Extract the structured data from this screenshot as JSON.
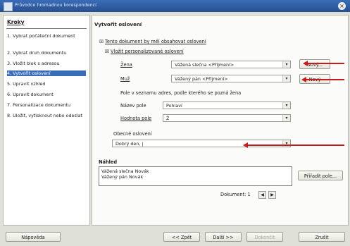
{
  "window": {
    "title": "Průvodce hromadnou korespondencí"
  },
  "steps": {
    "heading": "Kroky",
    "items": [
      {
        "label": "1. Vybrat počáteční dokument"
      },
      {
        "label": "2. Vybrat druh dokumentu"
      },
      {
        "label": "3. Vložit blok s adresou"
      },
      {
        "label": "4. Vytvořit oslovení"
      },
      {
        "label": "5. Upravit vzhled"
      },
      {
        "label": "6. Upravit dokument"
      },
      {
        "label": "7. Personalizace dokumentu"
      },
      {
        "label": "8. Uložit, vytisknout nebo odeslat"
      }
    ],
    "selected_index": 3
  },
  "main": {
    "title": "Vytvořit oslovení",
    "cb_salutation": "Tento dokument by měl obsahovat oslovení",
    "cb_personal": "Vložit personalizované oslovení",
    "female_label": "Žena",
    "female_value": "Vážená slečna <Příjmení>",
    "female_new": "Nový...",
    "male_label": "Muž",
    "male_value": "Vážený pán <Příjmení>",
    "male_new": "Nový",
    "field_desc": "Pole v seznamu adres, podle kterého se pozná žena",
    "fieldname_label": "Název pole",
    "fieldname_value": "Pohlaví",
    "fieldvalue_label": "Hodnota pole",
    "fieldvalue_value": "Ž",
    "general_label": "Obecné oslovení",
    "general_value": "Dobrý den, |",
    "preview_label": "Náhled",
    "preview_line1": "Vážená slečna Novák",
    "preview_line2": "Vážený pán Novák",
    "assign_button": "Přiřadit pole...",
    "doc_label": "Dokument: 1"
  },
  "footer": {
    "help": "Nápověda",
    "back": "<< Zpět",
    "next": "Další >>",
    "finish": "Dokončit",
    "cancel": "Zrušit"
  },
  "colors": {
    "annotation_arrow": "#c71a1a",
    "selection": "#3a6db8"
  }
}
